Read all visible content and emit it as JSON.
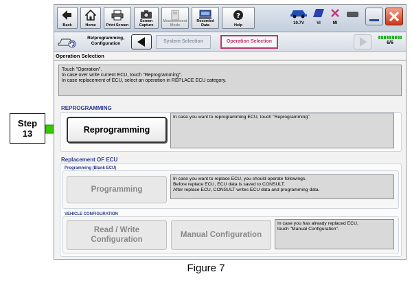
{
  "step": {
    "line1": "Step",
    "line2": "13"
  },
  "toolbar": {
    "back": "Back",
    "home": "Home",
    "print": "Print Screen",
    "capture": "Screen Capture",
    "measurement": "Measurement Mode",
    "recorded": "Recorded Data",
    "help": "Help",
    "voltage": "10.7V",
    "vi": "VI",
    "mi": "MI"
  },
  "nav": {
    "reprog": "Re/programming, Configuration",
    "system_selection": "System Selection",
    "operation_selection": "Operation Selection",
    "page": "6/6"
  },
  "screen_title": "Operation Selection",
  "instructions": [
    "Touch \"Operation\".",
    "In case over write current ECU, touch \"Reprogramming\".",
    "In case replacement of ECU, select an operation in REPLACE ECU category."
  ],
  "reprogramming": {
    "heading": "REPROGRAMMING",
    "button": "Reprogramming",
    "desc": "In case you want to reprogramming ECU, touch \"Reprogramming\"."
  },
  "replacement": {
    "heading": "Replacement OF ECU",
    "programming_sub": "Programming (Blank ECU)",
    "programming_button": "Programming",
    "programming_desc": [
      "In case you want to replace ECU, you should operate followings.",
      "Before replace ECU, ECU data is saved to CONSULT.",
      "After replace ECU, CONSULT writes ECU data and programming data."
    ],
    "vehicle_sub": "VEHICLE CONFIGURATION",
    "read_write_l1": "Read / Write",
    "read_write_l2": "Configuration",
    "manual_button": "Manual Configuration",
    "manual_desc": [
      "In case you has already replaced ECU,",
      "touch \"Manual Configuration\"."
    ]
  },
  "caption": "Figure 7",
  "colors": {
    "accent_pink": "#c0356a",
    "step_arrow": "#33cc00",
    "heading_blue": "#2b3a8c"
  }
}
